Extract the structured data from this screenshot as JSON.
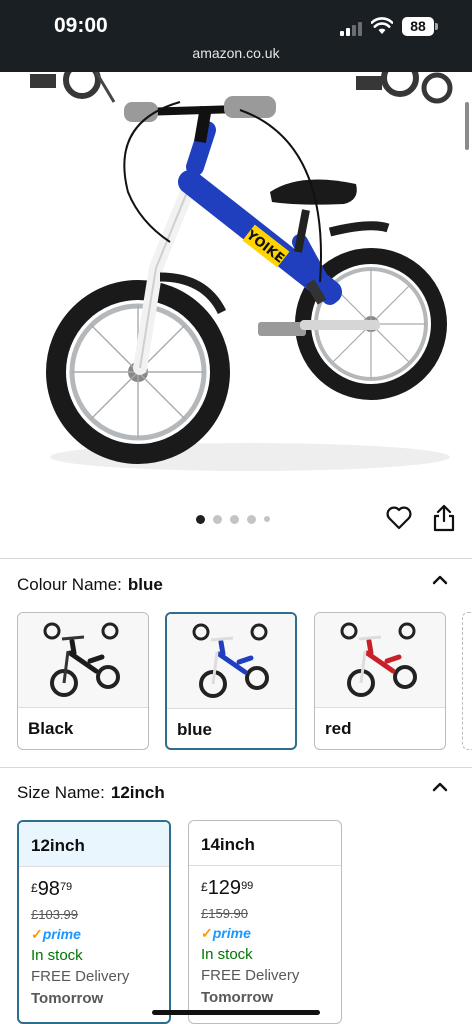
{
  "status_bar": {
    "time": "09:00",
    "battery": "88"
  },
  "browser": {
    "url": "amazon.co.uk"
  },
  "gallery": {
    "image_count": 5,
    "active_index": 0
  },
  "colour": {
    "label": "Colour Name:",
    "selected": "blue",
    "options": [
      {
        "label": "Black",
        "frame_color": "#1b1b1b"
      },
      {
        "label": "blue",
        "frame_color": "#1f3fbf"
      },
      {
        "label": "red",
        "frame_color": "#c8202a"
      }
    ]
  },
  "size": {
    "label": "Size Name:",
    "selected": "12inch",
    "options": [
      {
        "label": "12inch",
        "currency": "£",
        "whole": "98",
        "fraction": "79",
        "was": "£103.99",
        "prime": "prime",
        "stock": "In stock",
        "delivery": "FREE Delivery",
        "when": "Tomorrow"
      },
      {
        "label": "14inch",
        "currency": "£",
        "whole": "129",
        "fraction": "99",
        "was": "£159.90",
        "prime": "prime",
        "stock": "In stock",
        "delivery": "FREE Delivery",
        "when": "Tomorrow"
      }
    ]
  },
  "bike_badge": "YOIKE",
  "colors": {
    "accent_border": "#2d6e8e",
    "prime_blue": "#1a98ff",
    "in_stock_green": "#007600"
  }
}
